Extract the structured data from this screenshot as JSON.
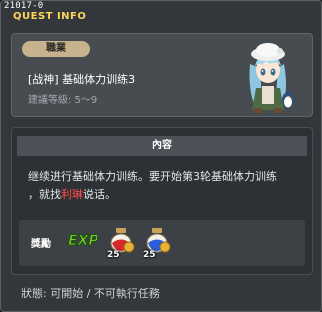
{
  "quest_id": "21017-0",
  "window_title": "QUEST INFO",
  "job_badge": "職業",
  "quest_name": "[战神] 基础体力训练3",
  "level_requirement": "建議等級: 5～9",
  "content_header": "內容",
  "description": {
    "line1": "继续进行基础体力训练。要开始第3轮基础体力训练",
    "line2_before": "，就找",
    "npc_name": "利琳",
    "line2_after": "说话。"
  },
  "rewards": {
    "label": "獎勵",
    "exp_label": "EXP",
    "items": [
      {
        "icon": "red-potion-icon",
        "count": "25"
      },
      {
        "icon": "blue-potion-icon",
        "count": "25"
      }
    ]
  },
  "status_text": "狀態: 可開始 / 不可執行任務",
  "colors": {
    "title": "#ffd45a",
    "npc_link": "#ff4a4a",
    "badge": "#c7b28d",
    "exp": "#6fd12a"
  }
}
